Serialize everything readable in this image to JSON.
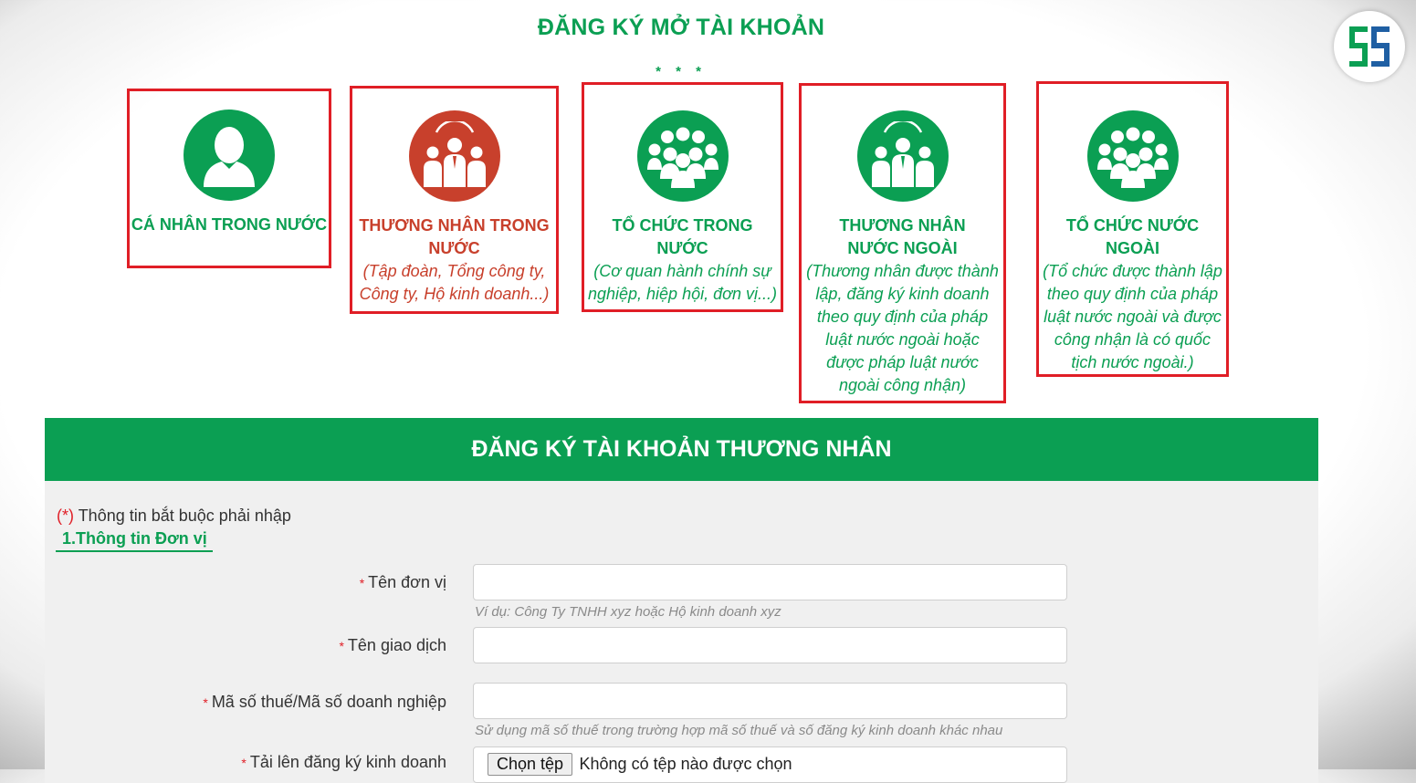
{
  "page_title": "ĐĂNG KÝ MỞ TÀI KHOẢN",
  "stars": "* * *",
  "cards": [
    {
      "title": "CÁ NHÂN TRONG NƯỚC",
      "desc": "",
      "icon": "person-icon",
      "color": "#0b9f53"
    },
    {
      "title": "THƯƠNG NHÂN TRONG NƯỚC",
      "desc": "(Tập đoàn, Tổng công ty, Công ty, Hộ kinh doanh...)",
      "icon": "business-people-icon",
      "color": "#c8402c"
    },
    {
      "title": "TỔ CHỨC TRONG NƯỚC",
      "desc": "(Cơ quan hành chính sự nghiệp, hiệp hội, đơn vị...)",
      "icon": "group-icon",
      "color": "#0b9f53"
    },
    {
      "title": "THƯƠNG NHÂN NƯỚC NGOÀI",
      "desc": "(Thương nhân được thành lập, đăng ký kinh doanh theo quy định của pháp luật nước ngoài hoặc được pháp luật nước ngoài công nhận)",
      "icon": "business-people-icon",
      "color": "#0b9f53"
    },
    {
      "title": "TỔ CHỨC NƯỚC NGOÀI",
      "desc": "(Tổ chức được thành lập theo quy định của pháp luật nước ngoài và được công nhận là có quốc tịch nước ngoài.)",
      "icon": "group-icon",
      "color": "#0b9f53"
    }
  ],
  "form": {
    "header": "ĐĂNG KÝ TÀI KHOẢN THƯƠNG NHÂN",
    "required_star": "(*)",
    "required_note": "Thông tin bắt buộc phải nhập",
    "section": "1.Thông tin Đơn vị",
    "fields": {
      "unit_name": {
        "label": "Tên đơn vị",
        "hint": "Ví dụ: Công Ty TNHH xyz hoặc Hộ kinh doanh xyz"
      },
      "trade_name": {
        "label": "Tên giao dịch"
      },
      "tax_code": {
        "label": "Mã số thuế/Mã số doanh nghiệp",
        "hint": "Sử dụng mã số thuế trong trường hợp mã số thuế và số đăng ký kinh doanh khác nhau"
      },
      "upload": {
        "label": "Tải lên đăng ký kinh doanh",
        "button": "Chọn tệp",
        "status": "Không có tệp nào được chọn"
      }
    }
  },
  "colors": {
    "brand_green": "#0b9f53",
    "accent_red": "#e01e26",
    "merchant_red": "#c8402c"
  }
}
